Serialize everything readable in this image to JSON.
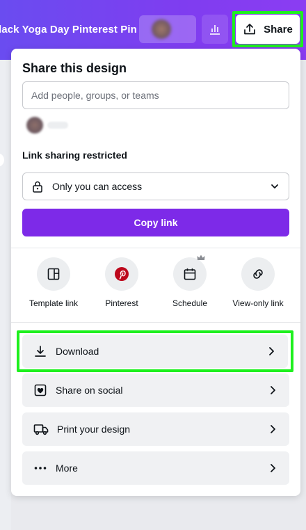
{
  "topbar": {
    "doc_title": "lack Yoga Day Pinterest Pin",
    "share_label": "Share"
  },
  "panel": {
    "title": "Share this design",
    "people_input_placeholder": "Add people, groups, or teams",
    "link_section_label": "Link sharing restricted",
    "access_value": "Only you can access",
    "copy_link_label": "Copy link",
    "quick_actions": [
      {
        "label": "Template link",
        "icon": "template-icon"
      },
      {
        "label": "Pinterest",
        "icon": "pinterest-icon"
      },
      {
        "label": "Schedule",
        "icon": "calendar-icon",
        "badge": "crown-icon"
      },
      {
        "label": "View-only link",
        "icon": "link-icon"
      }
    ],
    "rows": [
      {
        "label": "Download",
        "icon": "download-icon"
      },
      {
        "label": "Share on social",
        "icon": "heart-icon"
      },
      {
        "label": "Print your design",
        "icon": "truck-icon"
      },
      {
        "label": "More",
        "icon": "more-dots-icon"
      }
    ]
  },
  "colors": {
    "accent": "#7d2ae8",
    "topbar_start": "#6a4cf0",
    "highlight": "#1ef01e",
    "pinterest": "#bd081c"
  }
}
